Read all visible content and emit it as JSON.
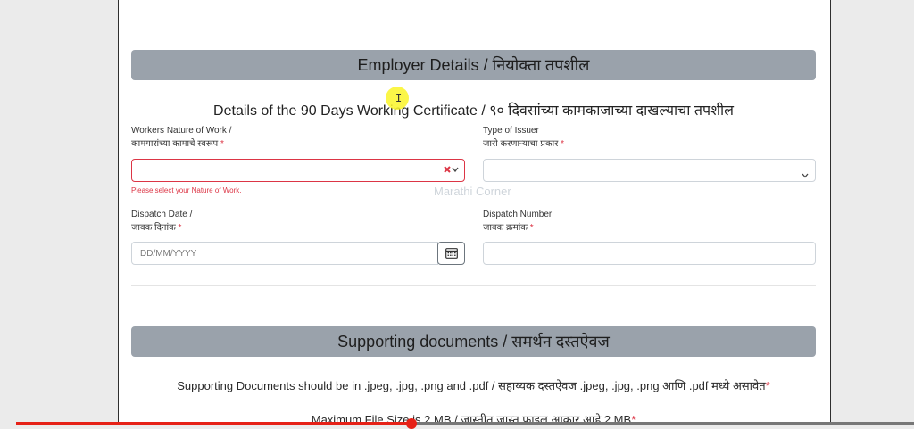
{
  "employer_section": {
    "title": "Employer Details / नियोक्ता तपशील"
  },
  "certificate_section": {
    "title": "Details of the 90 Days Working Certificate / ९० दिवसांच्या कामकाजाच्या दाखल्याचा तपशील"
  },
  "fields": {
    "nature_of_work": {
      "label_en": "Workers Nature of Work /",
      "label_mr": "कामगारांच्या कामाचे स्वरूप",
      "required": "*",
      "value": "",
      "error": "Please select your Nature of Work."
    },
    "type_of_issuer": {
      "label_en": "Type of Issuer",
      "label_mr": "जारी करणाऱ्याचा प्रकार",
      "required": "*",
      "value": ""
    },
    "dispatch_date": {
      "label_en": "Dispatch Date /",
      "label_mr": "जावक दिनांक",
      "required": "*",
      "placeholder": "DD/MM/YYYY"
    },
    "dispatch_number": {
      "label_en": "Dispatch Number",
      "label_mr": "जावक क्रमांक",
      "required": "*",
      "value": ""
    }
  },
  "watermark": "Marathi Corner",
  "supporting_section": {
    "title": "Supporting documents / समर्थन दस्तऐवज",
    "format_note": "Supporting Documents should be in .jpeg, .jpg, .png and .pdf / सहाय्यक दस्तऐवज .jpeg, .jpg, .png आणि .pdf मध्ये असावेत",
    "size_note": "Maximum File Size is 2 MB / जास्तीत जास्त फाइल आकार आहे 2 MB",
    "required": "*"
  },
  "video_progress": {
    "played_fraction": 0.44
  },
  "icons": {
    "clear": "clear-x-icon",
    "chevron": "chevron-down-icon",
    "calendar": "calendar-icon"
  },
  "colors": {
    "header_bg": "#9aa2ab",
    "error": "#dc3545",
    "progress": "#e62117"
  }
}
